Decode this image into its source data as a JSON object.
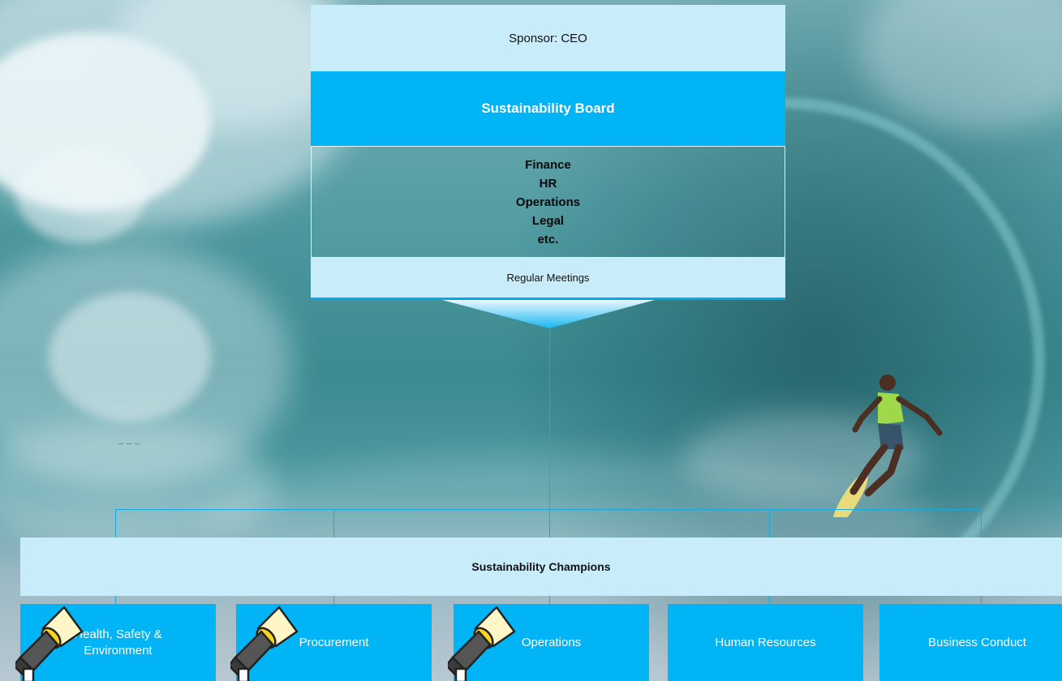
{
  "panel": {
    "sponsor": "Sponsor: CEO",
    "board": "Sustainability Board",
    "members": [
      "Finance",
      "HR",
      "Operations",
      "Legal",
      "etc."
    ],
    "meetings": "Regular Meetings"
  },
  "champions": {
    "label": "Sustainability Champions"
  },
  "departments": [
    {
      "label": "Health, Safety & Environment",
      "icon": "flashlight-icon"
    },
    {
      "label": "Procurement",
      "icon": "flashlight-icon"
    },
    {
      "label": "Operations",
      "icon": "flashlight-icon"
    },
    {
      "label": "Human Resources"
    },
    {
      "label": "Business Conduct"
    }
  ],
  "colors": {
    "accent": "#00b4f5",
    "light_panel": "#c9ecfa",
    "connector": "#15a9e3"
  }
}
